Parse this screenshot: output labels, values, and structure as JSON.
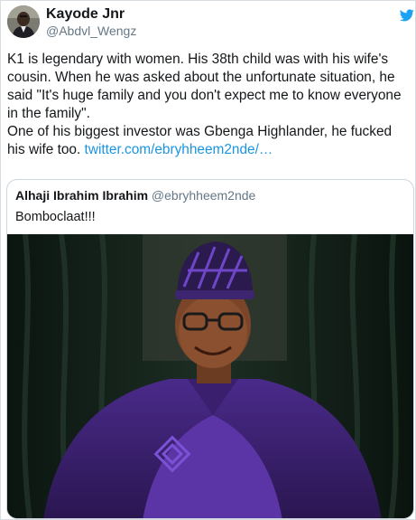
{
  "tweet": {
    "author_name": "Kayode Jnr",
    "author_handle": "@Abdvl_Wengz",
    "paragraph_1": "K1 is legendary with women. His 38th child was with his wife's cousin. When he was asked about the unfortunate situation, he said \"It's huge family and you don't expect me to know everyone in the family\".",
    "paragraph_2_text": "One of his biggest investor was Gbenga Highlander, he fucked his wife too. ",
    "paragraph_2_link": "twitter.com/ebryhheem2nde/…",
    "avatar_icon": "profile-photo",
    "platform_icon": "twitter-bird-icon",
    "link_color": "#1b95e0",
    "brand_color": "#1da1f2"
  },
  "quoted_tweet": {
    "author_name": "Alhaji Ibrahim Ibrahim",
    "author_handle": "@ebryhheem2nde",
    "text": "Bomboclaat!!!",
    "photo_icon": "portrait-photo"
  }
}
